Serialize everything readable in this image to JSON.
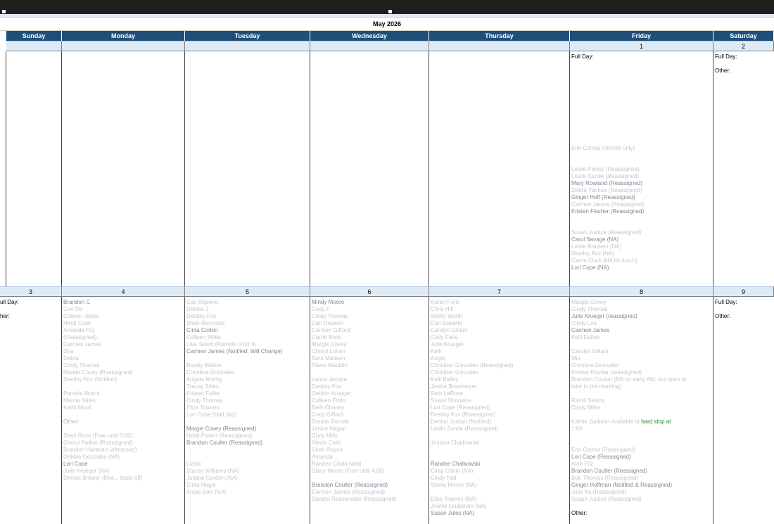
{
  "calendar": {
    "title": "May 2026",
    "weekdays": [
      "Sunday",
      "Monday",
      "Tuesday",
      "Wednesday",
      "Thursday",
      "Friday",
      "Saturday"
    ],
    "labels": {
      "full_day": "Full Day:",
      "other": "Other:",
      "full_day_cut": "ull Day:",
      "other_cut": "her:"
    },
    "week1": {
      "days": [
        "",
        "",
        "",
        "",
        "",
        "1",
        "2"
      ]
    },
    "week2": {
      "days": [
        "3",
        "4",
        "5",
        "6",
        "7",
        "8",
        "9"
      ]
    },
    "friday1": {
      "entries": [
        "Erin Correa (remote only)",
        "Leslie Parker (Reassigned)",
        "Leslie Sunde (Reassigned)",
        "Mary Rowland (Reassigned)",
        "Debra Yankee (Reassigned)",
        "Ginger Hoff (Reassigned)",
        "Carmen James (Reassigned)",
        "Kristen Fischer (Reassigned)"
      ],
      "other_entries": [
        "Susan Justice (Reassigned)",
        "Carol Savage (NA)",
        "Leslie Bracken (NA)",
        "Destiny Fox (NA)",
        "Carrie Clark (NA for lunch)",
        "Lori Cope (NA)"
      ]
    },
    "monday4": {
      "entries": [
        "Brandon C",
        "Cori De",
        "Colleen Jones",
        "Heidi Cook",
        "Amanda Fitz",
        "(Reassigned)",
        "Carmen James",
        "Dea",
        "Debra",
        "Cindy Thomas",
        "Mamie Covey (Reassigned)",
        "Destiny Fox (Notified)",
        "Pamela Morris",
        "Marcia Stiles",
        "Kathi Mouli"
      ],
      "other_entries": [
        "Shari Rose (Free until 5:00)",
        "Cheryl Parker (Reassigned)",
        "Brandon Hartman (afternoon)",
        "Debbie Gonzales (NA)",
        "Lori Cope",
        "Julie Krueger (NA)",
        "Dennis Brewer (Rea... team off)"
      ]
    },
    "tuesday5": {
      "entries": [
        "Cari Deperio",
        "Denise J",
        "Destiny Fox",
        "Shari Reynolds",
        "Cinta Corbin",
        "Colleen Stiles",
        "Lisa Tatum (Remote Until 3)",
        "Carmen James (Notified, Will Change)",
        "Randy Walker",
        "Christine Gonzales",
        "Angela Romig",
        "Tracey Stiles",
        "Kristen Fuller",
        "Cindy Thomas",
        "Eliza Townes",
        "Lori Cope (Half day)"
      ],
      "other_entries": [
        "Margie Covey (Reassigned)",
        "Heidi Parker (Reassigned)",
        "Brandon Coulter (Reassigned)",
        "Lizzie",
        "Stacey Williams (NA)",
        "Juliana Gordon (NA)",
        "Cinta Hagie",
        "Angie Barr (NA)"
      ]
    },
    "wednesday6": {
      "entries": [
        "Mindy Moore",
        "Cody F",
        "Cindy Thomas",
        "Cari Deperio",
        "Carmen Gifford",
        "Carrie Bock",
        "Margie Covey",
        "Cheryl Lohan",
        "Sara Mattson",
        "Diane Mauldin",
        "Lance Jacoba",
        "Destiny Fox",
        "Debbie Krueger",
        "Colleen Eddo",
        "Beth Chaney",
        "Cody Gifford",
        "Dennis Burnett",
        "Janice Hagan"
      ],
      "other_entries": [
        "Chris Mills",
        "Alexis Cash",
        "Shari Reyes",
        "Amanda",
        "Randee Chalkowski",
        "Stacy Morris (Free until 4:00)",
        "Brandon Coulter (Reassigned)",
        "Carmen James (Reassigned)",
        "Sandra Reasonable (Reassigned)"
      ]
    },
    "thursday7": {
      "entries": [
        "Karen Ford",
        "Chris Hill",
        "Shelly Worth",
        "Cari Deperio",
        "Carolyn Gillam",
        "Cody Faris",
        "Julie Krueger",
        "Kelli",
        "Angie",
        "Christine Gonzales (Reassigned)",
        "Christine Gonzales",
        "Kelli Bailey",
        "Janice Brewmeyer",
        "Beth LaRose",
        "Susan Dimovice",
        "Lori Cope (Reassigned)",
        "Destiny Fox (Reassigned)",
        "Denise Jordan (Notified)",
        "Leslie Sunde (Reassigned)"
      ],
      "other_entries": [
        "Jessica Chalkowski",
        "Randee Chalkowski",
        "Cinta Carlin (NA)",
        "Cindy Hall",
        "Sheila Rivers (NA)",
        "Elise Townes (NA)",
        "Joanie Lindaman (NA)",
        "Susan Jules (NA)"
      ]
    },
    "friday8": {
      "entries": [
        "Margie Covey",
        "Cindy Thomas",
        "Julie Krueger (reassigned)",
        "Cindy Lee",
        "Carmen James",
        "Kelli Dalton",
        "Carolyn Gillam",
        "Mia",
        "Christine Gonzales",
        "Kristen Fischer (reassigned)",
        "Brandon Coulter (NA for early AM, but open to",
        "later in the morning)",
        "Randi Sexton",
        "Cindy Miles",
        "Kathie Jackson available at",
        "1:00"
      ],
      "hard_stop_text": "hard stop at",
      "other_entries": [
        "Erin Correa (Reassigned)",
        "Lori Cope (Reassigned)",
        "Alan Fitz",
        "Brandon Coulter (Reassigned)",
        "Bob Thomas (Reassigned)",
        "Ginger Hoffman (Notified & Reassigned)",
        "Julie Ko (Reassigned)",
        "Susan Justice (Reassigned)"
      ]
    }
  }
}
